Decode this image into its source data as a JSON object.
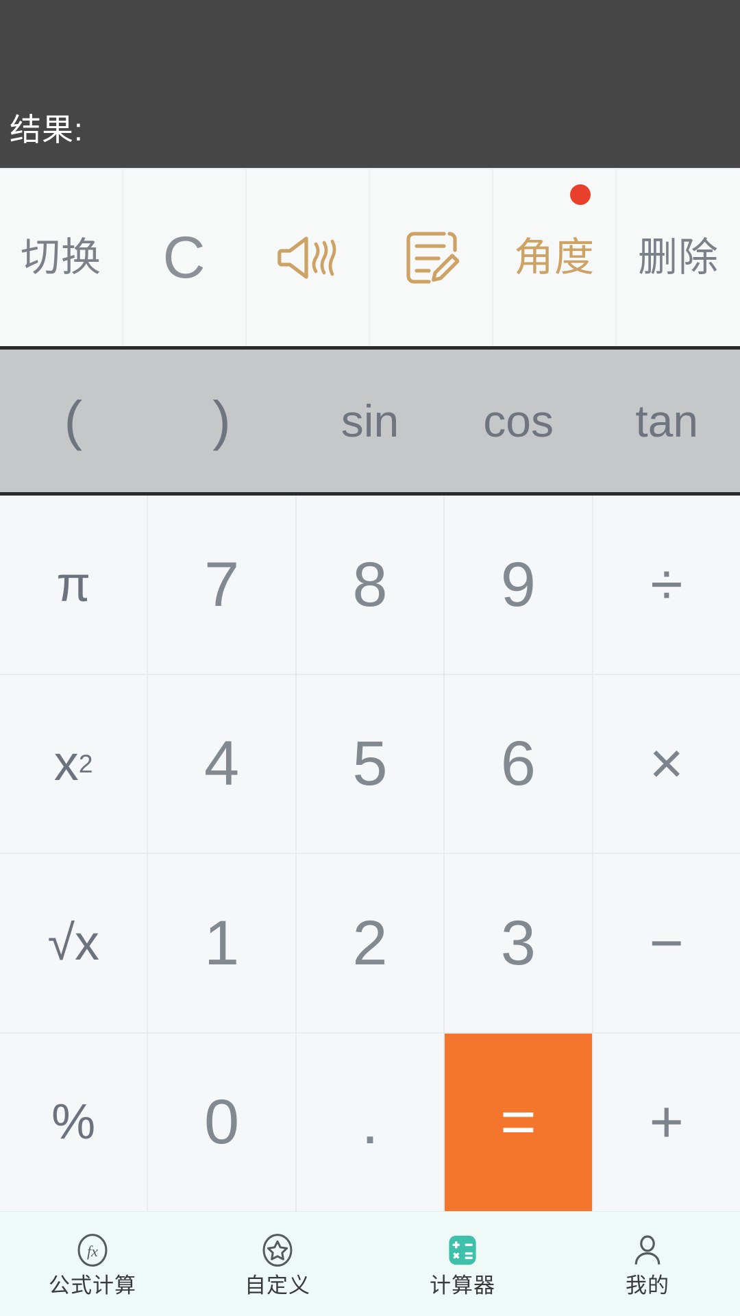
{
  "app": {
    "title": "计算器",
    "accent_orange": "#f4762c",
    "accent_gold": "#cda265",
    "accent_teal": "#3fc0ab",
    "badge_red": "#e8402a",
    "display_bg": "#464646",
    "sci_row_bg": "#c6c7c9",
    "nav_bg": "#effaf8"
  },
  "display": {
    "expression": "",
    "result": "结果:"
  },
  "function_row": [
    {
      "name": "switch",
      "label": "切换",
      "style": "text",
      "badge": false
    },
    {
      "name": "clear",
      "label": "C",
      "style": "clear",
      "badge": false
    },
    {
      "name": "sound",
      "label": "",
      "icon": "sound-icon",
      "style": "icon",
      "badge": false
    },
    {
      "name": "note",
      "label": "",
      "icon": "note-edit-icon",
      "style": "icon",
      "badge": false
    },
    {
      "name": "angle",
      "label": "角度",
      "style": "accent",
      "badge": true
    },
    {
      "name": "delete",
      "label": "删除",
      "style": "text",
      "badge": false
    }
  ],
  "sci_row": [
    {
      "name": "open-paren",
      "label": "(",
      "kind": "paren"
    },
    {
      "name": "close-paren",
      "label": ")",
      "kind": "paren"
    },
    {
      "name": "sin",
      "label": "sin",
      "kind": "fn"
    },
    {
      "name": "cos",
      "label": "cos",
      "kind": "fn"
    },
    {
      "name": "tan",
      "label": "tan",
      "kind": "fn"
    }
  ],
  "keypad": [
    [
      {
        "name": "pi",
        "label": "π",
        "kind": "fn"
      },
      {
        "name": "seven",
        "label": "7",
        "kind": "num"
      },
      {
        "name": "eight",
        "label": "8",
        "kind": "num"
      },
      {
        "name": "nine",
        "label": "9",
        "kind": "num"
      },
      {
        "name": "divide",
        "label": "÷",
        "kind": "op"
      }
    ],
    [
      {
        "name": "x-squared",
        "label": "x²",
        "kind": "fn",
        "base": "x",
        "sup": "2"
      },
      {
        "name": "four",
        "label": "4",
        "kind": "num"
      },
      {
        "name": "five",
        "label": "5",
        "kind": "num"
      },
      {
        "name": "six",
        "label": "6",
        "kind": "num"
      },
      {
        "name": "multiply",
        "label": "×",
        "kind": "op"
      }
    ],
    [
      {
        "name": "square-root",
        "label": "√x",
        "kind": "fn"
      },
      {
        "name": "one",
        "label": "1",
        "kind": "num"
      },
      {
        "name": "two",
        "label": "2",
        "kind": "num"
      },
      {
        "name": "three",
        "label": "3",
        "kind": "num"
      },
      {
        "name": "subtract",
        "label": "−",
        "kind": "op"
      }
    ],
    [
      {
        "name": "percent",
        "label": "%",
        "kind": "fn"
      },
      {
        "name": "zero",
        "label": "0",
        "kind": "num"
      },
      {
        "name": "decimal",
        "label": ".",
        "kind": "num"
      },
      {
        "name": "equals",
        "label": "=",
        "kind": "equals"
      },
      {
        "name": "add",
        "label": "+",
        "kind": "op"
      }
    ]
  ],
  "bottom_nav": [
    {
      "name": "formula-calc",
      "label": "公式计算",
      "icon": "fx-circle-icon",
      "active": false
    },
    {
      "name": "custom",
      "label": "自定义",
      "icon": "star-circle-icon",
      "active": false
    },
    {
      "name": "calculator",
      "label": "计算器",
      "icon": "calculator-icon",
      "active": true
    },
    {
      "name": "mine",
      "label": "我的",
      "icon": "person-icon",
      "active": false
    }
  ]
}
